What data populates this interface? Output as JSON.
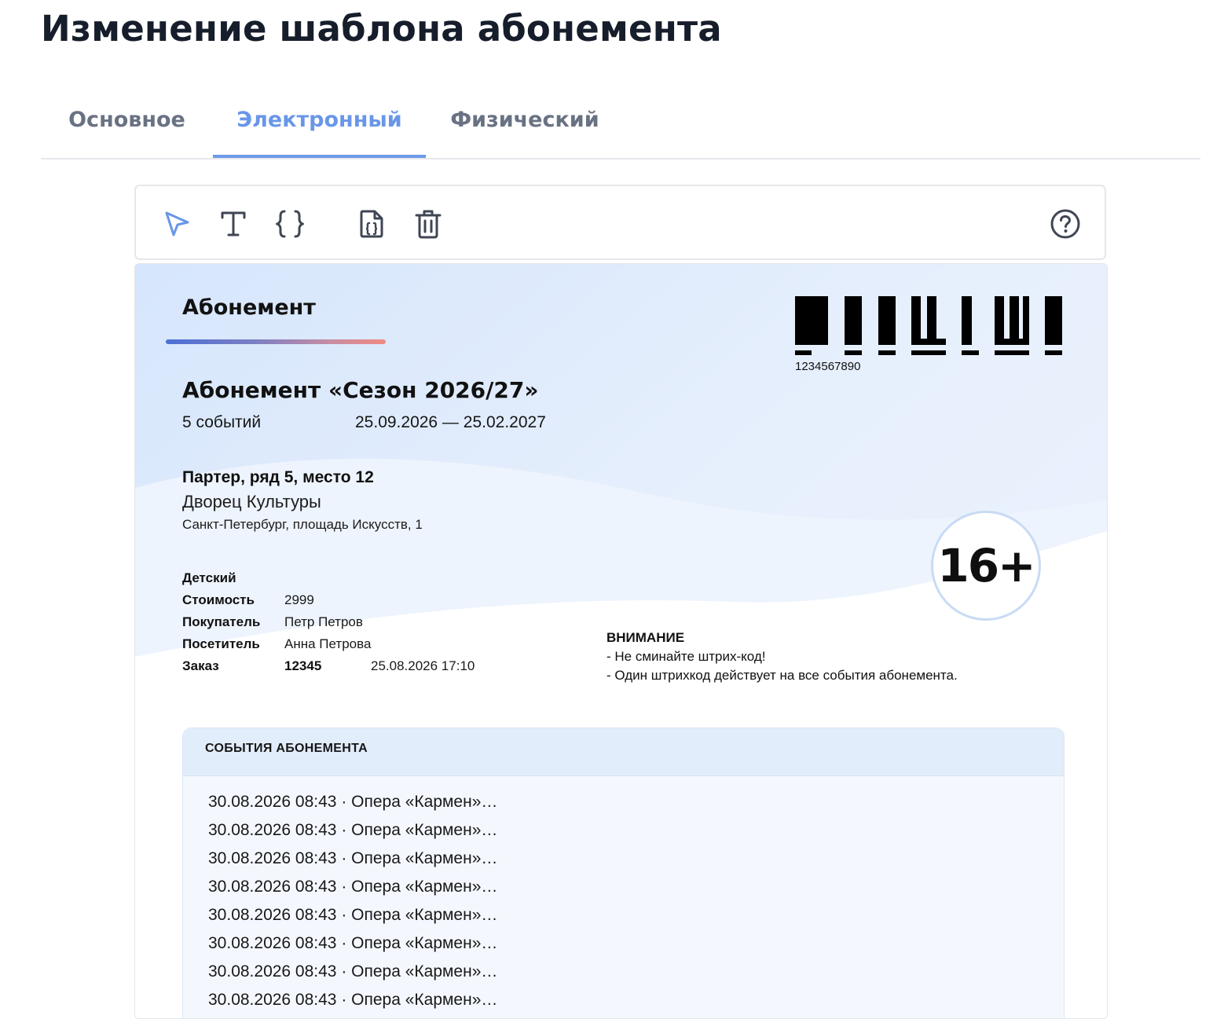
{
  "page": {
    "title": "Изменение шаблона абонемента"
  },
  "tabs": [
    {
      "label": "Основное",
      "active": false
    },
    {
      "label": "Электронный",
      "active": true
    },
    {
      "label": "Физический",
      "active": false
    }
  ],
  "toolbar": {
    "tools": [
      {
        "name": "select-tool",
        "icon": "cursor-arrow-icon",
        "active": true
      },
      {
        "name": "text-tool",
        "icon": "text-icon",
        "active": false
      },
      {
        "name": "variable-tool",
        "icon": "curly-braces-icon",
        "active": false
      },
      {
        "name": "insert-code-file-tool",
        "icon": "code-file-icon",
        "active": false
      },
      {
        "name": "delete-tool",
        "icon": "trash-icon",
        "active": false
      }
    ],
    "help_icon": "help-circle-icon",
    "active_color": "#6996e8",
    "icon_color": "#3f4654"
  },
  "ticket": {
    "label": "Абонемент",
    "barcode_number": "1234567890",
    "season_title": "Абонемент «Сезон 2026/27»",
    "events_count": "5 событий",
    "date_range": "25.09.2026 — 25.02.2027",
    "seat": "Партер, ряд 5, место 12",
    "venue": "Дворец Культуры",
    "address": "Санкт-Петербург, площадь Искусств, 1",
    "age_rating": "16+",
    "category": "Детский",
    "fields": {
      "price_label": "Стоимость",
      "price_value": "2999",
      "buyer_label": "Покупатель",
      "buyer_value": "Петр Петров",
      "visitor_label": "Посетитель",
      "visitor_value": "Анна Петрова",
      "order_label": "Заказ",
      "order_number": "12345",
      "order_datetime": "25.08.2026 17:10"
    },
    "warning": {
      "title": "ВНИМАНИЕ",
      "lines": [
        "- Не сминайте штрих-код!",
        "- Один штрихкод действует на все события абонемента."
      ]
    },
    "events_section": {
      "title": "СОБЫТИЯ АБОНЕМЕНТА",
      "items": [
        "30.08.2026 08:43 · Опера «Кармен»…",
        "30.08.2026 08:43 · Опера «Кармен»…",
        "30.08.2026 08:43 · Опера «Кармен»…",
        "30.08.2026 08:43 · Опера «Кармен»…",
        "30.08.2026 08:43 · Опера «Кармен»…",
        "30.08.2026 08:43 · Опера «Кармен»…",
        "30.08.2026 08:43 · Опера «Кармен»…",
        "30.08.2026 08:43 · Опера «Кармен»…"
      ]
    }
  }
}
